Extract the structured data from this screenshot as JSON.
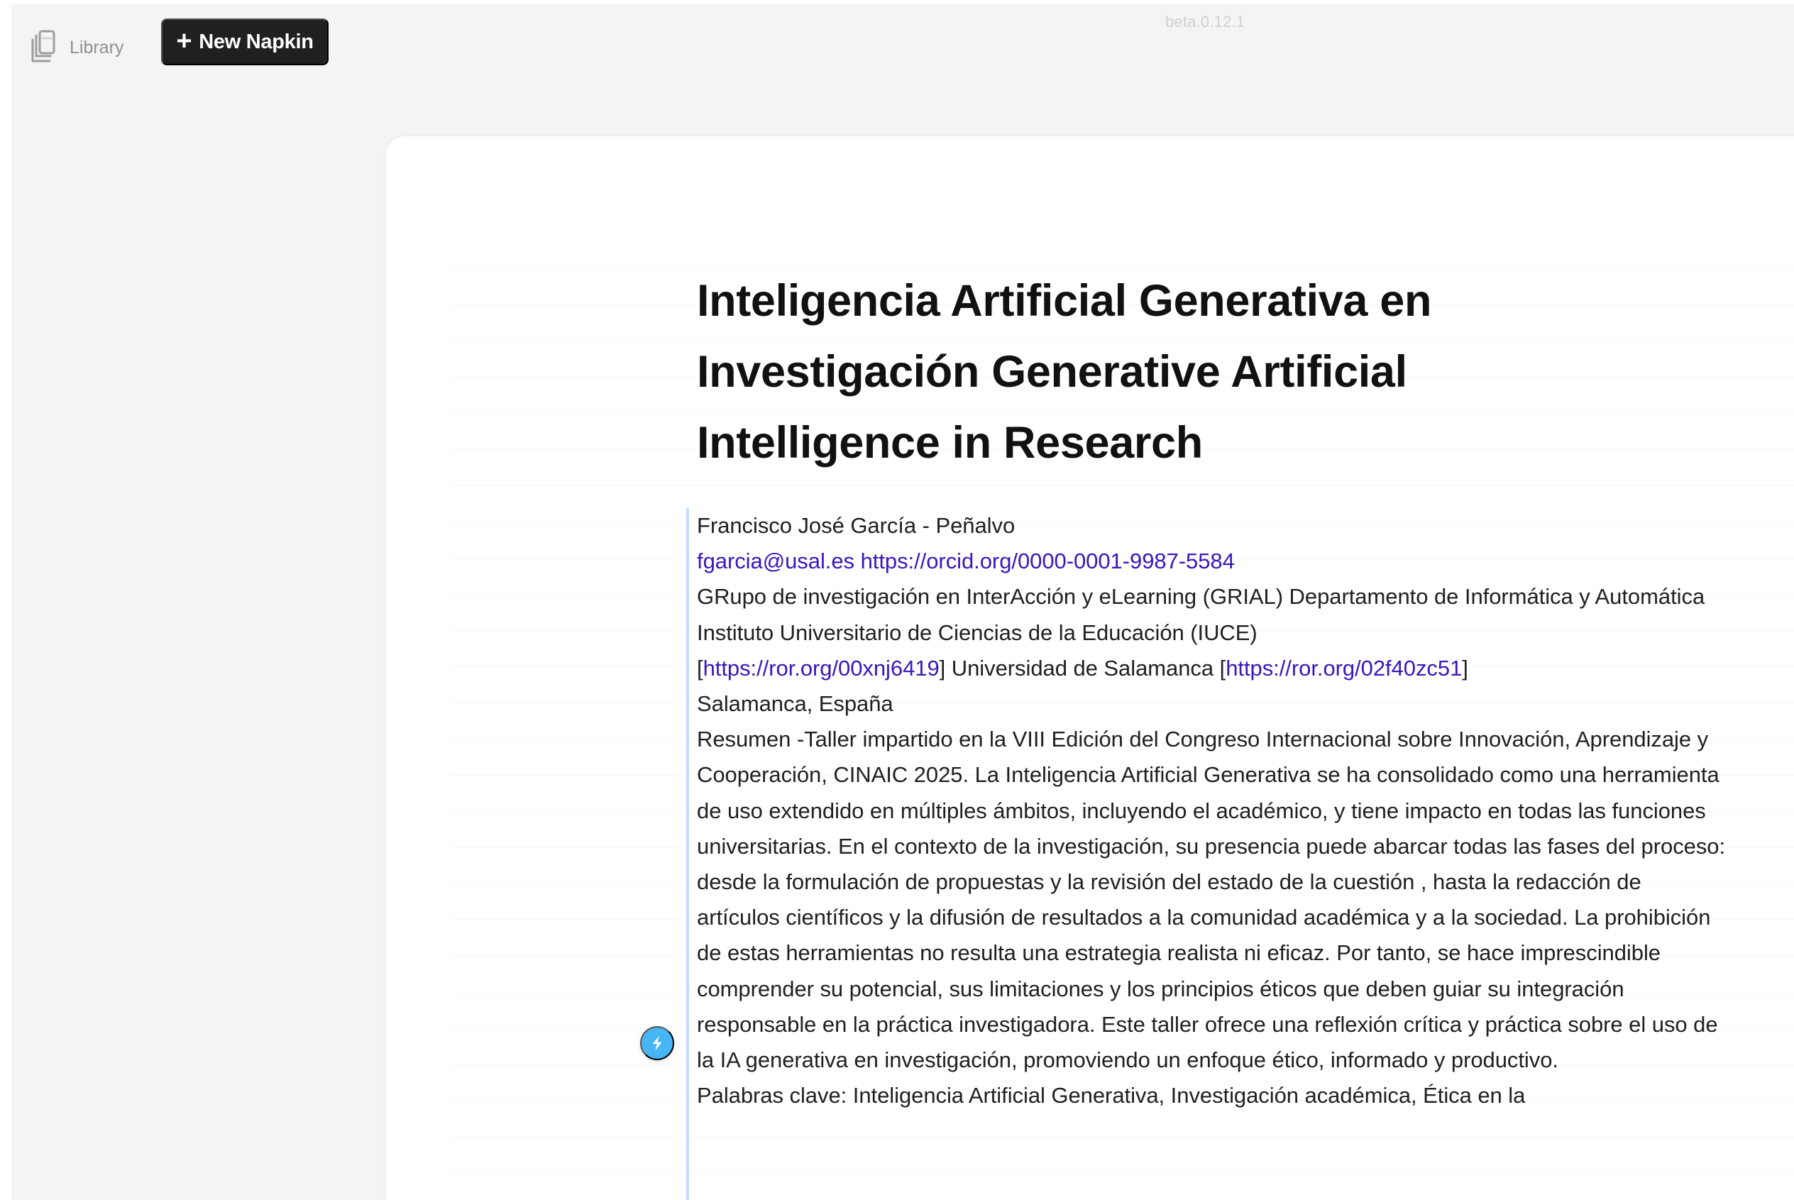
{
  "top_bar": {
    "library_label": "Library",
    "library_icon": "library-icon",
    "new_napkin_label": "New Napkin",
    "new_napkin_icon": "plus-icon",
    "version": "beta.0.12.1"
  },
  "document": {
    "title": "Inteligencia Artificial Generativa en Investigación Generative Artificial Intelligence in Research",
    "author": "Francisco José García - Peñalvo",
    "email": "fgarcia@usal.es",
    "orcid_url": "https://orcid.org/0000-0001-9987-5584",
    "affiliation_1": "GRupo de investigación en InterAcción y eLearning (GRIAL) Departamento de Informática y Automática Instituto Universitario de Ciencias de la Educación (IUCE)",
    "ror_open": "[",
    "ror_link_1": "https://ror.org/00xnj6419",
    "ror_mid": "] Universidad de Salamanca [",
    "ror_link_2": "https://ror.org/02f40zc51",
    "ror_close": "]",
    "location": "Salamanca, España",
    "abstract": "Resumen -Taller impartido en la VIII Edición del Congreso Internacional sobre Innovación, Aprendizaje y Cooperación, CINAIC 2025. La Inteligencia Artificial Generativa se ha consolidado como una herramienta de uso extendido en múltiples ámbitos, incluyendo el académico, y tiene impacto en todas las funciones universitarias. En el contexto de la investigación, su presencia puede abarcar todas las fases del proceso: desde la formulación de propuestas y la revisión del estado de la cuestión , hasta la redacción de artículos científicos y la difusión de resultados a la comunidad académica y a la sociedad. La prohibición de estas herramientas no resulta una estrategia realista ni eficaz. Por tanto, se hace imprescindible comprender su potencial, sus limitaciones y los principios éticos que deben guiar su integración responsable en la práctica investigadora. Este taller ofrece una reflexión crítica y práctica sobre el uso de la IA generativa en investigación, promoviendo un enfoque ético, informado y productivo.",
    "keywords": "Palabras clave: Inteligencia Artificial Generativa, Investigación académica, Ética en la"
  },
  "floating": {
    "spark_icon": "lightning-bolt-icon"
  },
  "colors": {
    "link": "#3b16bd",
    "spark_button": "#48b6f4",
    "new_napkin_button": "#202020"
  }
}
